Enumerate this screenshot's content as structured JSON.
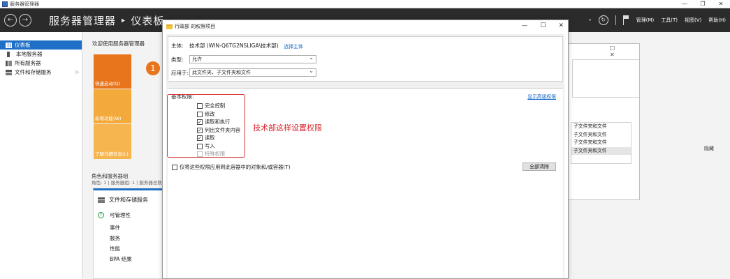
{
  "outer_window": {
    "title": "服务器管理器",
    "controls": [
      "—",
      "❐",
      "✕"
    ]
  },
  "header": {
    "back_glyph": "←",
    "forward_glyph": "→",
    "title": "服务器管理器 ‣ 仪表板",
    "dropdown_glyph": "•",
    "refresh_glyph": "↻",
    "menus": [
      "管理(M)",
      "工具(T)",
      "视图(V)",
      "帮助(H)"
    ]
  },
  "sidebar": {
    "items": [
      {
        "label": "仪表板",
        "icon": "dashboard-icon",
        "selected": true
      },
      {
        "label": "本地服务器",
        "icon": "local-server-icon"
      },
      {
        "label": "所有服务器",
        "icon": "all-servers-icon"
      },
      {
        "label": "文件和存储服务",
        "icon": "file-storage-icon",
        "expand": "▷"
      }
    ]
  },
  "dashboard": {
    "welcome": "欢迎使用服务器管理器",
    "tiles": [
      "快速启动(Q)",
      "新增功能(W)",
      "了解详细信息(L)"
    ],
    "step_number": "1",
    "roles_title": "角色和服务器组",
    "roles_subtitle": "角色: 1 | 服务器组: 1 | 服务器总数: 1",
    "role_card": {
      "title": "文件和存储服务",
      "status_icon": "↑",
      "status": "可管理性",
      "items": [
        "事件",
        "服务",
        "性能",
        "BPA 结果"
      ]
    },
    "hide_label": "隐藏"
  },
  "bg_dialog": {
    "controls": [
      "☐",
      "✕"
    ],
    "list": [
      "子文件夹和文件",
      "子文件夹和文件",
      "子文件夹和文件",
      "子文件夹和文件"
    ]
  },
  "dialog": {
    "title": "行政部 的权限项目",
    "controls": [
      "—",
      "☐",
      "✕"
    ],
    "principal_label": "主体:",
    "principal_value": "技术部 (WIN-Q6TG2NSLIGA\\技术部)",
    "select_principal": "选择主体",
    "type_label": "类型:",
    "type_value": "允许",
    "applies_label": "应用于:",
    "applies_value": "此文件夹、子文件夹和文件",
    "basic_perms_label": "基本权限:",
    "advanced_link": "显示高级权限",
    "permissions": [
      {
        "label": "完全控制",
        "checked": false,
        "disabled": false
      },
      {
        "label": "修改",
        "checked": false,
        "disabled": false
      },
      {
        "label": "读取和执行",
        "checked": true,
        "disabled": false
      },
      {
        "label": "列出文件夹内容",
        "checked": true,
        "disabled": false
      },
      {
        "label": "读取",
        "checked": true,
        "disabled": false
      },
      {
        "label": "写入",
        "checked": false,
        "disabled": false
      },
      {
        "label": "特殊权限",
        "checked": false,
        "disabled": true
      }
    ],
    "apply_only_label": "仅将这些权限应用到此容器中的对象和/或容器(T)",
    "clear_all": "全部清除",
    "annotation": "技术部这样设置权限",
    "check_glyph": "✓"
  }
}
